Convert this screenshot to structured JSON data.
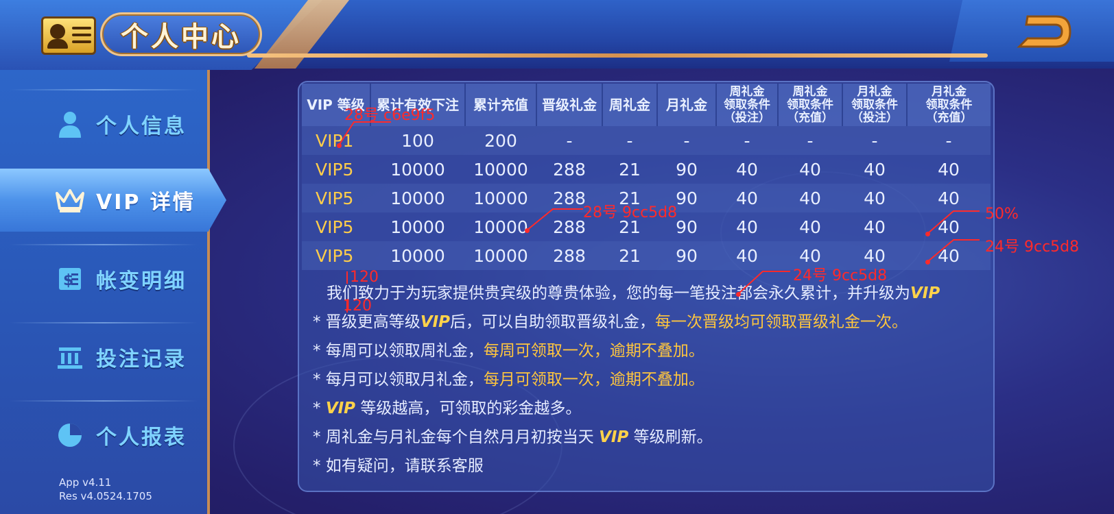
{
  "header": {
    "title": "个人中心",
    "back_icon": "back-arrow-icon",
    "profile_icon": "profile-card-icon"
  },
  "sidebar": {
    "items": [
      {
        "label": "个人信息",
        "icon": "user-icon"
      },
      {
        "label": "VIP 详情",
        "icon": "crown-icon"
      },
      {
        "label": "帐变明细",
        "icon": "bill-icon"
      },
      {
        "label": "投注记录",
        "icon": "building-icon"
      },
      {
        "label": "个人报表",
        "icon": "pie-chart-icon"
      }
    ],
    "active_index": 1,
    "version_app": "App  v4.11",
    "version_res": "Res  v4.0524.1705"
  },
  "table": {
    "headers": [
      "VIP 等级",
      "累计有效下注",
      "累计充值",
      "晋级礼金",
      "周礼金",
      "月礼金",
      "周礼金\n领取条件\n（投注）",
      "周礼金\n领取条件\n（充值）",
      "月礼金\n领取条件\n（投注）",
      "月礼金\n领取条件\n（充值）"
    ],
    "rows": [
      [
        "VIP1",
        "100",
        "200",
        "-",
        "-",
        "-",
        "-",
        "-",
        "-",
        "-"
      ],
      [
        "VIP5",
        "10000",
        "10000",
        "288",
        "21",
        "90",
        "40",
        "40",
        "40",
        "40"
      ],
      [
        "VIP5",
        "10000",
        "10000",
        "288",
        "21",
        "90",
        "40",
        "40",
        "40",
        "40"
      ],
      [
        "VIP5",
        "10000",
        "10000",
        "288",
        "21",
        "90",
        "40",
        "40",
        "40",
        "40"
      ],
      [
        "VIP5",
        "10000",
        "10000",
        "288",
        "21",
        "90",
        "40",
        "40",
        "40",
        "40"
      ]
    ]
  },
  "notes": {
    "intro": "我们致力于为玩家提供贵宾级的尊贵体验，您的每一笔投注都会永久累计，并升级为",
    "intro_vip": "VIP",
    "n1_a": "* 晋级更高等级",
    "n1_vip": "VIP",
    "n1_b": "后，可以自助领取晋级礼金，",
    "n1_hi": "每一次晋级均可领取晋级礼金一次。",
    "n2_a": "* 每周可以领取周礼金，",
    "n2_hi": "每周可领取一次，逾期不叠加。",
    "n3_a": "* 每月可以领取月礼金，",
    "n3_hi": "每月可领取一次，逾期不叠加。",
    "n4_a": "* ",
    "n4_vip": "VIP",
    "n4_b": " 等级越高，可领取的彩金越多。",
    "n5_a": "* 周礼金与月礼金每个自然月月初按当天 ",
    "n5_vip": "VIP",
    "n5_b": " 等级刷新。",
    "n6": "* 如有疑问，请联系客服"
  },
  "annotations": {
    "a1": "28号 c6e9f5",
    "a2": "28号 9cc5d8",
    "a3": "50%",
    "a4": "24号 9cc5d8",
    "a5": "24号 9cc5d8",
    "a6": "120",
    "a7": "120",
    "color": "#ff2a2a"
  },
  "colors": {
    "accent_gold": "#ffc63e",
    "header_text": "#c6e9f5",
    "body_text": "#9cc5d8",
    "sidebar_label": "#7fd3ff"
  }
}
